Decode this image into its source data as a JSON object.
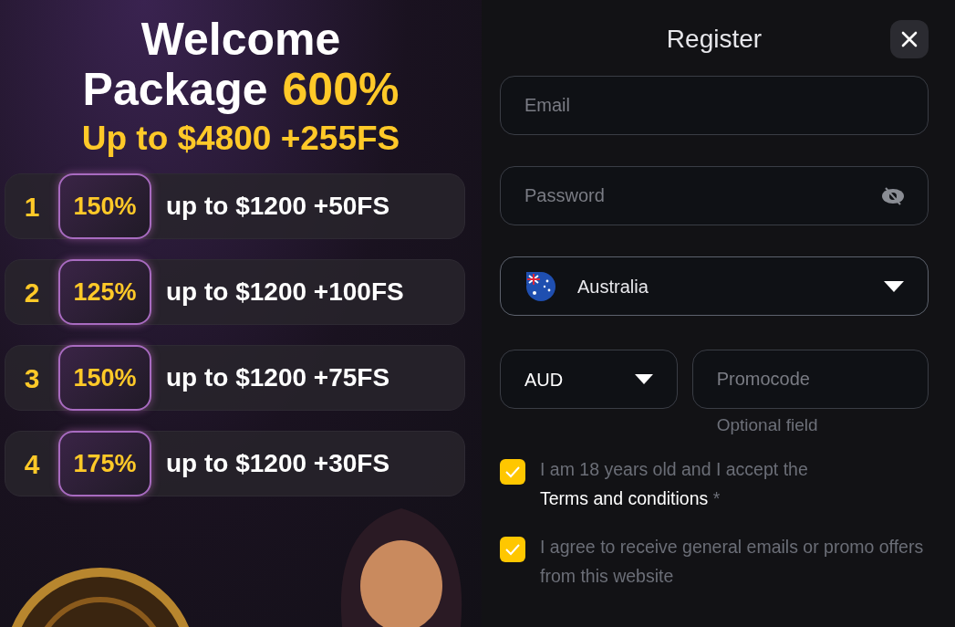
{
  "promo": {
    "title_line_1": "Welcome",
    "title_line_2": "Package",
    "title_highlight": "600%",
    "subtitle": "Up to $4800 +255FS",
    "tiers": [
      {
        "number": "1",
        "percent": "150%",
        "reward": "up to $1200 +50FS"
      },
      {
        "number": "2",
        "percent": "125%",
        "reward": "up to $1200 +100FS"
      },
      {
        "number": "3",
        "percent": "150%",
        "reward": "up to $1200 +75FS"
      },
      {
        "number": "4",
        "percent": "175%",
        "reward": "up to $1200 +30FS"
      }
    ]
  },
  "register": {
    "title": "Register",
    "email": {
      "placeholder": "Email"
    },
    "password": {
      "placeholder": "Password"
    },
    "country": {
      "value": "Australia"
    },
    "currency": {
      "value": "AUD"
    },
    "promocode": {
      "placeholder": "Promocode",
      "hint": "Optional field"
    },
    "consents": [
      {
        "text": "I am 18 years old and I accept the ",
        "link": "Terms and conditions",
        "suffix": " *",
        "checked": true
      },
      {
        "text": "I agree to receive general emails or promo offers from this website",
        "checked": true
      }
    ]
  }
}
